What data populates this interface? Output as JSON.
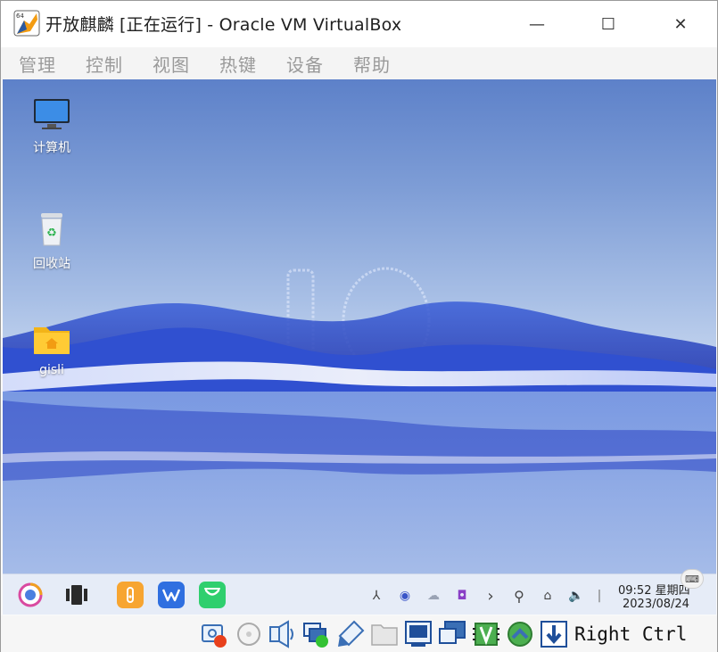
{
  "window": {
    "title": "开放麒麟 [正在运行] - Oracle VM VirtualBox",
    "icon_badge": "64",
    "controls": {
      "minimize": "—",
      "maximize": "☐",
      "close": "✕"
    }
  },
  "menubar": {
    "items": [
      {
        "label": "管理"
      },
      {
        "label": "控制"
      },
      {
        "label": "视图"
      },
      {
        "label": "热键"
      },
      {
        "label": "设备"
      },
      {
        "label": "帮助"
      }
    ]
  },
  "desktop": {
    "icons": [
      {
        "label": "计算机",
        "icon": "computer-icon"
      },
      {
        "label": "回收站",
        "icon": "recycle-bin-icon"
      },
      {
        "label": "gisli",
        "icon": "home-folder-icon"
      }
    ],
    "wallpaper_text": "10"
  },
  "taskbar": {
    "apps": [
      {
        "icon": "start-menu-icon"
      },
      {
        "icon": "multitask-view-icon"
      },
      {
        "icon": "file-manager-icon"
      },
      {
        "icon": "wps-office-icon"
      },
      {
        "icon": "software-store-icon"
      }
    ],
    "tray": [
      {
        "icon": "network-share-icon",
        "glyph": "⅄"
      },
      {
        "icon": "app-indicator-icon",
        "glyph": "◉"
      },
      {
        "icon": "cloud-icon",
        "glyph": "☁"
      },
      {
        "icon": "camera-app-icon",
        "glyph": "◘"
      },
      {
        "icon": "expand-tray-icon",
        "glyph": "›"
      },
      {
        "icon": "search-icon",
        "glyph": "⚲"
      },
      {
        "icon": "network-settings-icon",
        "glyph": "⌂"
      },
      {
        "icon": "volume-icon",
        "glyph": "🔈"
      },
      {
        "icon": "notification-separator",
        "glyph": "|"
      }
    ],
    "clock": {
      "time": "09:52 星期四",
      "date": "2023/08/24"
    },
    "keyboard_label": "⌨"
  },
  "statusbar": {
    "icons": [
      "hard-disk-icon",
      "optical-drive-icon",
      "audio-icon",
      "network-icon",
      "usb-icon",
      "shared-folders-icon",
      "display-icon",
      "video-capture-icon",
      "cpu-virtualization-icon",
      "mouse-integration-icon",
      "host-key-indicator-icon"
    ],
    "host_key": "Right Ctrl"
  },
  "colors": {
    "desktop_top": "#5d81c9",
    "desktop_bottom": "#9bb4e2",
    "taskbar": "#e6ecf7",
    "menu_text": "#9a9a9a"
  }
}
